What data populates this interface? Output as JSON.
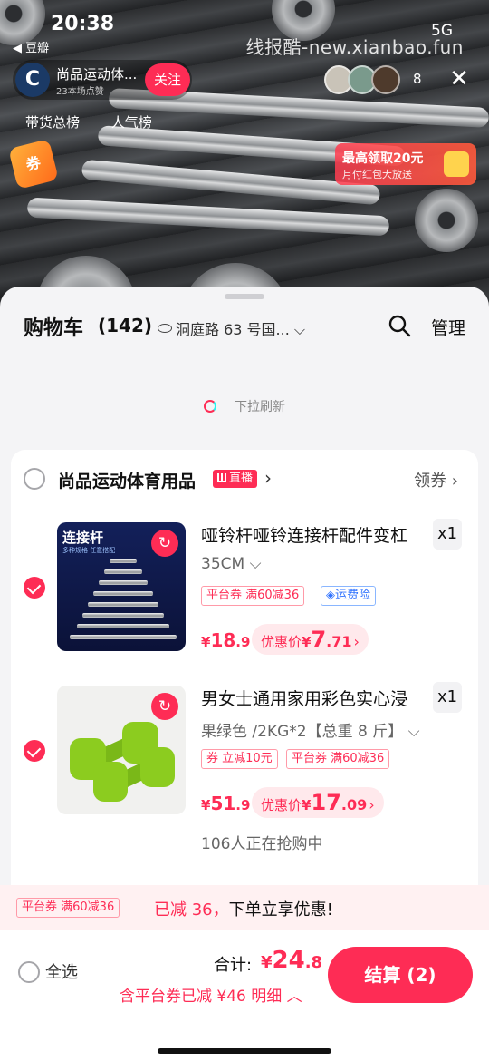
{
  "status": {
    "time": "20:38",
    "network": "5G",
    "back_app": "◀ 豆瓣"
  },
  "watermark": "线报酷-new.xianbao.fun",
  "live": {
    "anchor_avatar_letter": "C",
    "anchor_name": "尚品运动体...",
    "anchor_sub": "23本场点赞",
    "follow": "关注",
    "viewer_count": "8",
    "close": "✕",
    "rank_tabs": [
      "带货总榜",
      "人气榜"
    ],
    "coupon_bag": "券",
    "promo_title": "最高领取20元",
    "promo_sub": "月付红包大放送"
  },
  "cart": {
    "title": "购物车",
    "count": "(142)",
    "address": "洞庭路 63 号国...",
    "manage": "管理",
    "refresh": "下拉刷新",
    "store": {
      "name": "尚品运动体育用品",
      "live_tag": "直播",
      "coupon": "领券"
    },
    "items": [
      {
        "title": "哑铃杆哑铃连接杆配件变杠",
        "qty": "x1",
        "spec": "35CM",
        "tags": [
          "平台券 满60减36",
          "运费险"
        ],
        "price_cur": "¥",
        "price_int": "18",
        "price_dec": ".9",
        "deal_label": "优惠价",
        "deal_cur": "¥",
        "deal_int": "7",
        "deal_dec": ".71",
        "image_title": "连接杆",
        "image_sub": "多种规格 任意搭配",
        "checked": true
      },
      {
        "title": "男女士通用家用彩色实心浸",
        "qty": "x1",
        "spec": "果绿色 /2KG*2【总重 8 斤】",
        "tags": [
          "券 立减10元",
          "平台券 满60减36"
        ],
        "price_cur": "¥",
        "price_int": "51",
        "price_dec": ".9",
        "deal_label": "优惠价",
        "deal_cur": "¥",
        "deal_int": "17",
        "deal_dec": ".09",
        "buying": "106人正在抢购中",
        "checked": true
      }
    ]
  },
  "promo_strip": {
    "tag": "平台券 满60减36",
    "highlight": "已减 36，",
    "text": "下单立享优惠!"
  },
  "footer": {
    "select_all": "全选",
    "total_label": "合计:",
    "total_cur": "¥",
    "total_int": "24",
    "total_dec": ".8",
    "discount_line": "含平台券已减 ¥46 明细 ︿",
    "checkout": "结算 (2)"
  },
  "colors": {
    "accent": "#fe2c55",
    "deal_bg": "#ffe9ec",
    "sheet_bg": "#f4f4f6",
    "blue_tag": "#2f72ff"
  }
}
